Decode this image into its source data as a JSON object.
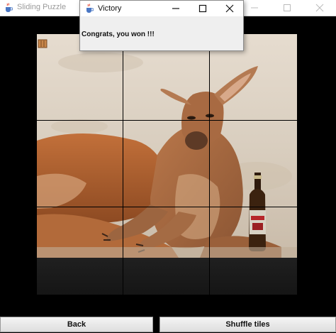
{
  "main_window": {
    "title": "Sliding Puzzle",
    "icon": "java-cup-icon"
  },
  "dialog": {
    "title": "Victory",
    "message": "Congrats, you won !!!",
    "icon": "java-cup-icon"
  },
  "buttons": {
    "back_label": "Back",
    "shuffle_label": "Shuffle tiles"
  },
  "board": {
    "rows": 3,
    "cols": 3,
    "image_subject": "kangaroo-with-beer-bottle",
    "tiles": [
      1,
      2,
      3,
      4,
      5,
      6,
      7,
      8,
      0
    ]
  },
  "colors": {
    "background": "#000000",
    "titlebar": "#ffffff",
    "dialog_bg": "#efefef",
    "button_bg": "#e6e6e6"
  }
}
